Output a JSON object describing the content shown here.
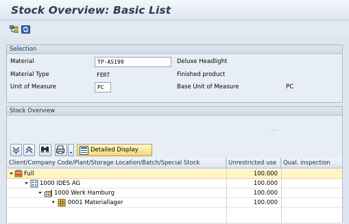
{
  "window": {
    "title": "Stock Overview: Basic List"
  },
  "toolbar": {
    "icons": [
      "hierarchy-icon",
      "refresh-icon"
    ]
  },
  "selection": {
    "header": "Selection",
    "material_label": "Material",
    "material_value": "TP-AS199",
    "material_desc": "Deluxe Headlight",
    "type_label": "Material Type",
    "type_value": "FERT",
    "type_desc": "Finished product",
    "uom_label": "Unit of Measure",
    "uom_value": "PC",
    "base_uom_label": "Base Unit of Measure",
    "base_uom_value": "PC"
  },
  "stock": {
    "header": "Stock Overview",
    "dots": ".....",
    "detailed_display": "Detailed Display",
    "columns": [
      "Client/Company Code/Plant/Storage Location/Batch/Special Stock",
      "Unrestricted use",
      "Qual. inspection"
    ],
    "rows": [
      {
        "label": "Full",
        "icon": "full-icon",
        "unrestricted": "100.000",
        "qual": ""
      },
      {
        "label": "1000 IDES AG",
        "icon": "company-code-icon",
        "unrestricted": "100.000",
        "qual": ""
      },
      {
        "label": "1000 Werk Hamburg",
        "icon": "plant-icon",
        "unrestricted": "100.000",
        "qual": ""
      },
      {
        "label": "0001 Materiallager",
        "icon": "storage-location-icon",
        "unrestricted": "100.000",
        "qual": ""
      }
    ]
  },
  "colors": {
    "highlight": "#fff4c4",
    "panel": "#e8eef5",
    "title": "#2f3c4f"
  }
}
